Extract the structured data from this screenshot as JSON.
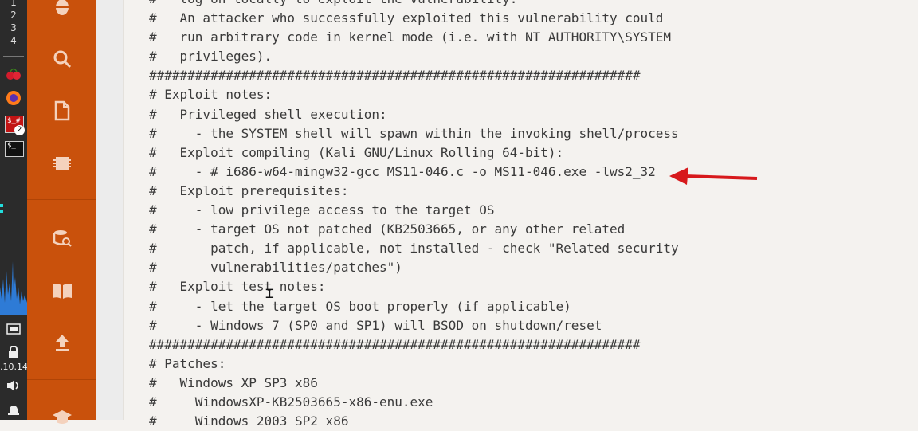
{
  "panel": {
    "workspaces": [
      "1",
      "2",
      "3",
      "4"
    ],
    "apps": [
      "cherrytree-icon",
      "firefox-icon",
      "terminal-root-icon",
      "terminal-icon"
    ],
    "terminal_badge": "2",
    "ip_text": ".10.14"
  },
  "sidebar": {
    "icons": [
      "bug-icon",
      "search-icon",
      "document-icon",
      "chip-icon",
      "database-search-icon",
      "book-icon",
      "upload-icon",
      "graduation-cap-icon"
    ]
  },
  "code": {
    "lines": [
      "#   log on locally to exploit the vulnerability.",
      "#   An attacker who successfully exploited this vulnerability could",
      "#   run arbitrary code in kernel mode (i.e. with NT AUTHORITY\\SYSTEM",
      "#   privileges).",
      "################################################################",
      "# Exploit notes:",
      "#   Privileged shell execution:",
      "#     - the SYSTEM shell will spawn within the invoking shell/process",
      "#   Exploit compiling (Kali GNU/Linux Rolling 64-bit):",
      "#     - # i686-w64-mingw32-gcc MS11-046.c -o MS11-046.exe -lws2_32",
      "#   Exploit prerequisites:",
      "#     - low privilege access to the target OS",
      "#     - target OS not patched (KB2503665, or any other related",
      "#       patch, if applicable, not installed - check \"Related security",
      "#       vulnerabilities/patches\")",
      "#   Exploit test notes:",
      "#     - let the target OS boot properly (if applicable)",
      "#     - Windows 7 (SP0 and SP1) will BSOD on shutdown/reset",
      "################################################################",
      "# Patches:",
      "#   Windows XP SP3 x86",
      "#     WindowsXP-KB2503665-x86-enu.exe",
      "#     Windows 2003 SP2 x86"
    ]
  },
  "colors": {
    "sidebar": "#c9510c",
    "panel": "#2b2b2b",
    "arrow": "#d7191c",
    "background": "#f4f2ef"
  }
}
